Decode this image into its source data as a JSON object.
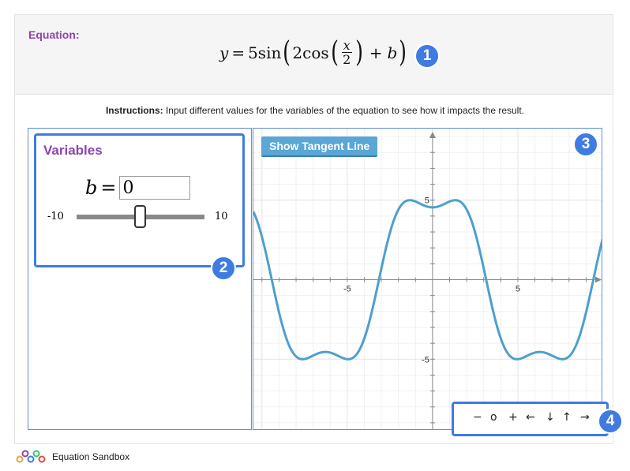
{
  "header": {
    "equation_label": "Equation:",
    "formula": {
      "lhs": "y",
      "equals": "=",
      "coef": "5sin",
      "inner_coef": "2cos",
      "frac_num": "x",
      "frac_den": "2",
      "plus": "+",
      "var": "b"
    },
    "badge": "1"
  },
  "instructions": {
    "bold": "Instructions:",
    "text": " Input different values for the variables of the equation to see how it impacts the result."
  },
  "variables": {
    "title": "Variables",
    "var_name": "b",
    "equals": "=",
    "value": "0",
    "slider_min": "-10",
    "slider_max": "10",
    "slider_value": 0,
    "badge": "2"
  },
  "graph": {
    "tangent_button": "Show Tangent Line",
    "badge": "3",
    "chart_data": {
      "type": "line",
      "function": "y = 5sin(2cos(x/2) + b)",
      "b": 0,
      "xlim": [
        -10.5,
        10
      ],
      "ylim": [
        -9.5,
        9.5
      ],
      "x_ticks": [
        -5,
        5
      ],
      "y_ticks": [
        5,
        -5
      ],
      "x_tick_labels": [
        "-5",
        "5"
      ],
      "y_tick_labels": [
        "5",
        "-5"
      ],
      "grid": true,
      "color": "#4da0cc"
    }
  },
  "nav": {
    "badge": "4",
    "buttons": [
      "−",
      "o",
      "+",
      "←",
      "↓",
      "↑",
      "→"
    ]
  },
  "footer": {
    "app_name": "Equation Sandbox"
  },
  "colors": {
    "accent": "#3f7be0",
    "label_purple": "#8e44ad",
    "curve": "#4da0cc"
  }
}
